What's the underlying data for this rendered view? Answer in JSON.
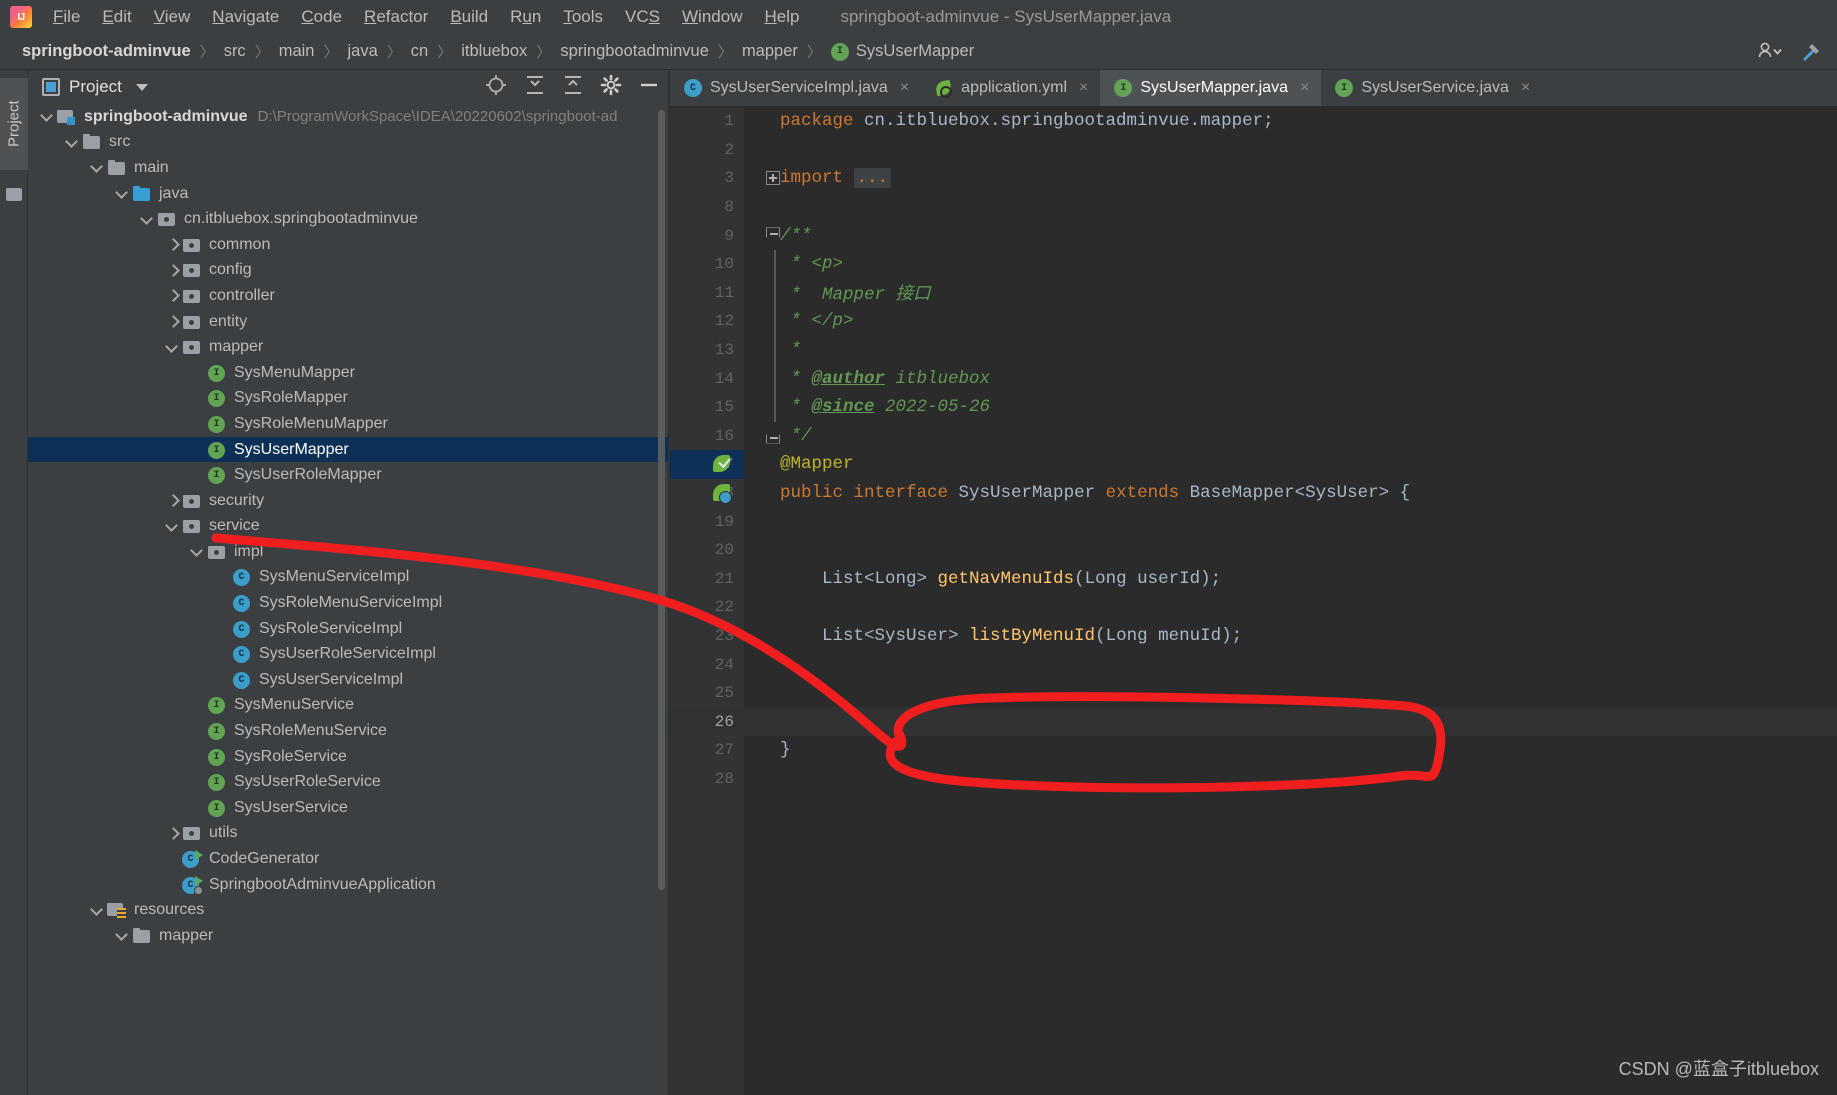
{
  "window": {
    "title": "springboot-adminvue - SysUserMapper.java",
    "logo_icon": "intellij-idea-logo"
  },
  "menubar": {
    "items": [
      {
        "label": "File",
        "mnemonic": "F"
      },
      {
        "label": "Edit",
        "mnemonic": "E"
      },
      {
        "label": "View",
        "mnemonic": "V"
      },
      {
        "label": "Navigate",
        "mnemonic": "N"
      },
      {
        "label": "Code",
        "mnemonic": "C"
      },
      {
        "label": "Refactor",
        "mnemonic": "R"
      },
      {
        "label": "Build",
        "mnemonic": "B"
      },
      {
        "label": "Run",
        "mnemonic": "u"
      },
      {
        "label": "Tools",
        "mnemonic": "T"
      },
      {
        "label": "VCS",
        "mnemonic": "S"
      },
      {
        "label": "Window",
        "mnemonic": "W"
      },
      {
        "label": "Help",
        "mnemonic": "H"
      }
    ]
  },
  "breadcrumb": {
    "separator": "〉",
    "items": [
      {
        "label": "springboot-adminvue",
        "bold": true,
        "icon": null
      },
      {
        "label": "src",
        "bold": false,
        "icon": null
      },
      {
        "label": "main",
        "bold": false,
        "icon": null
      },
      {
        "label": "java",
        "bold": false,
        "icon": null
      },
      {
        "label": "cn",
        "bold": false,
        "icon": null
      },
      {
        "label": "itbluebox",
        "bold": false,
        "icon": null
      },
      {
        "label": "springbootadminvue",
        "bold": false,
        "icon": null
      },
      {
        "label": "mapper",
        "bold": false,
        "icon": null
      },
      {
        "label": "SysUserMapper",
        "bold": false,
        "icon": "interface-icon"
      }
    ],
    "right_icons": [
      "user-access-icon",
      "chevron-down-icon",
      "hammer-icon"
    ]
  },
  "toolstrip": {
    "label": "Project",
    "icons": [
      "project-icon",
      "structure-icon"
    ]
  },
  "project_panel": {
    "title": "Project",
    "header_icons": [
      "locate-icon",
      "expand-all-icon",
      "collapse-all-icon",
      "settings-gear-icon",
      "hide-icon"
    ],
    "tree": [
      {
        "depth": 0,
        "arrow": "down",
        "icon": "module",
        "label": "springboot-adminvue",
        "bold": true,
        "subpath": "D:\\ProgramWorkSpace\\IDEA\\20220602\\springboot-ad",
        "selected": false
      },
      {
        "depth": 1,
        "arrow": "down",
        "icon": "folder",
        "label": "src",
        "bold": false,
        "subpath": "",
        "selected": false
      },
      {
        "depth": 2,
        "arrow": "down",
        "icon": "folder",
        "label": "main",
        "bold": false,
        "subpath": "",
        "selected": false
      },
      {
        "depth": 3,
        "arrow": "down",
        "icon": "folder-src",
        "label": "java",
        "bold": false,
        "subpath": "",
        "selected": false
      },
      {
        "depth": 4,
        "arrow": "down",
        "icon": "pkg",
        "label": "cn.itbluebox.springbootadminvue",
        "bold": false,
        "subpath": "",
        "selected": false
      },
      {
        "depth": 5,
        "arrow": "right",
        "icon": "pkg",
        "label": "common",
        "bold": false,
        "subpath": "",
        "selected": false
      },
      {
        "depth": 5,
        "arrow": "right",
        "icon": "pkg",
        "label": "config",
        "bold": false,
        "subpath": "",
        "selected": false
      },
      {
        "depth": 5,
        "arrow": "right",
        "icon": "pkg",
        "label": "controller",
        "bold": false,
        "subpath": "",
        "selected": false
      },
      {
        "depth": 5,
        "arrow": "right",
        "icon": "pkg",
        "label": "entity",
        "bold": false,
        "subpath": "",
        "selected": false
      },
      {
        "depth": 5,
        "arrow": "down",
        "icon": "pkg",
        "label": "mapper",
        "bold": false,
        "subpath": "",
        "selected": false
      },
      {
        "depth": 6,
        "arrow": "none",
        "icon": "iface",
        "label": "SysMenuMapper",
        "bold": false,
        "subpath": "",
        "selected": false
      },
      {
        "depth": 6,
        "arrow": "none",
        "icon": "iface",
        "label": "SysRoleMapper",
        "bold": false,
        "subpath": "",
        "selected": false
      },
      {
        "depth": 6,
        "arrow": "none",
        "icon": "iface",
        "label": "SysRoleMenuMapper",
        "bold": false,
        "subpath": "",
        "selected": false
      },
      {
        "depth": 6,
        "arrow": "none",
        "icon": "iface",
        "label": "SysUserMapper",
        "bold": false,
        "subpath": "",
        "selected": true
      },
      {
        "depth": 6,
        "arrow": "none",
        "icon": "iface",
        "label": "SysUserRoleMapper",
        "bold": false,
        "subpath": "",
        "selected": false
      },
      {
        "depth": 5,
        "arrow": "right",
        "icon": "pkg",
        "label": "security",
        "bold": false,
        "subpath": "",
        "selected": false
      },
      {
        "depth": 5,
        "arrow": "down",
        "icon": "pkg",
        "label": "service",
        "bold": false,
        "subpath": "",
        "selected": false
      },
      {
        "depth": 6,
        "arrow": "down",
        "icon": "pkg",
        "label": "impl",
        "bold": false,
        "subpath": "",
        "selected": false
      },
      {
        "depth": 7,
        "arrow": "none",
        "icon": "cls",
        "label": "SysMenuServiceImpl",
        "bold": false,
        "subpath": "",
        "selected": false
      },
      {
        "depth": 7,
        "arrow": "none",
        "icon": "cls",
        "label": "SysRoleMenuServiceImpl",
        "bold": false,
        "subpath": "",
        "selected": false
      },
      {
        "depth": 7,
        "arrow": "none",
        "icon": "cls",
        "label": "SysRoleServiceImpl",
        "bold": false,
        "subpath": "",
        "selected": false
      },
      {
        "depth": 7,
        "arrow": "none",
        "icon": "cls",
        "label": "SysUserRoleServiceImpl",
        "bold": false,
        "subpath": "",
        "selected": false
      },
      {
        "depth": 7,
        "arrow": "none",
        "icon": "cls",
        "label": "SysUserServiceImpl",
        "bold": false,
        "subpath": "",
        "selected": false
      },
      {
        "depth": 6,
        "arrow": "none",
        "icon": "iface",
        "label": "SysMenuService",
        "bold": false,
        "subpath": "",
        "selected": false
      },
      {
        "depth": 6,
        "arrow": "none",
        "icon": "iface",
        "label": "SysRoleMenuService",
        "bold": false,
        "subpath": "",
        "selected": false
      },
      {
        "depth": 6,
        "arrow": "none",
        "icon": "iface",
        "label": "SysRoleService",
        "bold": false,
        "subpath": "",
        "selected": false
      },
      {
        "depth": 6,
        "arrow": "none",
        "icon": "iface",
        "label": "SysUserRoleService",
        "bold": false,
        "subpath": "",
        "selected": false
      },
      {
        "depth": 6,
        "arrow": "none",
        "icon": "iface",
        "label": "SysUserService",
        "bold": false,
        "subpath": "",
        "selected": false
      },
      {
        "depth": 5,
        "arrow": "right",
        "icon": "pkg",
        "label": "utils",
        "bold": false,
        "subpath": "",
        "selected": false
      },
      {
        "depth": 5,
        "arrow": "none",
        "icon": "cls-run",
        "label": "CodeGenerator",
        "bold": false,
        "subpath": "",
        "selected": false
      },
      {
        "depth": 5,
        "arrow": "none",
        "icon": "cls-run-spring",
        "label": "SpringbootAdminvueApplication",
        "bold": false,
        "subpath": "",
        "selected": false
      },
      {
        "depth": 2,
        "arrow": "down",
        "icon": "resources",
        "label": "resources",
        "bold": false,
        "subpath": "",
        "selected": false
      },
      {
        "depth": 3,
        "arrow": "down",
        "icon": "folder",
        "label": "mapper",
        "bold": false,
        "subpath": "",
        "selected": false
      }
    ]
  },
  "editor": {
    "tabs": [
      {
        "label": "SysUserServiceImpl.java",
        "icon": "class-icon",
        "active": false,
        "close": "×"
      },
      {
        "label": "application.yml",
        "icon": "spring-yaml-icon",
        "active": false,
        "close": "×"
      },
      {
        "label": "SysUserMapper.java",
        "icon": "interface-icon",
        "active": true,
        "close": "×"
      },
      {
        "label": "SysUserService.java",
        "icon": "interface-icon",
        "active": false,
        "close": "×"
      }
    ],
    "lines": [
      {
        "num": "1",
        "fold": "none",
        "gutter": "none",
        "caret": false,
        "gutter_hl": false,
        "tokens": [
          {
            "t": "package ",
            "c": "kw"
          },
          {
            "t": "cn.itbluebox.springbootadminvue.mapper;",
            "c": "txt"
          }
        ]
      },
      {
        "num": "2",
        "fold": "none",
        "gutter": "none",
        "caret": false,
        "gutter_hl": false,
        "tokens": []
      },
      {
        "num": "3",
        "fold": "plus",
        "gutter": "none",
        "caret": false,
        "gutter_hl": false,
        "tokens": [
          {
            "t": "import ",
            "c": "kw"
          },
          {
            "t": "...",
            "c": "foldimport"
          }
        ]
      },
      {
        "num": "8",
        "fold": "none",
        "gutter": "none",
        "caret": false,
        "gutter_hl": false,
        "tokens": []
      },
      {
        "num": "9",
        "fold": "start",
        "gutter": "none",
        "caret": false,
        "gutter_hl": false,
        "tokens": [
          {
            "t": "/**",
            "c": "cmt"
          }
        ]
      },
      {
        "num": "10",
        "fold": "line",
        "gutter": "none",
        "caret": false,
        "gutter_hl": false,
        "tokens": [
          {
            "t": " * <p>",
            "c": "cmt"
          }
        ]
      },
      {
        "num": "11",
        "fold": "line",
        "gutter": "none",
        "caret": false,
        "gutter_hl": false,
        "tokens": [
          {
            "t": " *  Mapper 接口",
            "c": "cmt"
          }
        ]
      },
      {
        "num": "12",
        "fold": "line",
        "gutter": "none",
        "caret": false,
        "gutter_hl": false,
        "tokens": [
          {
            "t": " * </p>",
            "c": "cmt"
          }
        ]
      },
      {
        "num": "13",
        "fold": "line",
        "gutter": "none",
        "caret": false,
        "gutter_hl": false,
        "tokens": [
          {
            "t": " *",
            "c": "cmt"
          }
        ]
      },
      {
        "num": "14",
        "fold": "line",
        "gutter": "none",
        "caret": false,
        "gutter_hl": false,
        "tokens": [
          {
            "t": " * ",
            "c": "cmt"
          },
          {
            "t": "@author",
            "c": "cmttag"
          },
          {
            "t": " itbluebox",
            "c": "cmt"
          }
        ]
      },
      {
        "num": "15",
        "fold": "line",
        "gutter": "none",
        "caret": false,
        "gutter_hl": false,
        "tokens": [
          {
            "t": " * ",
            "c": "cmt"
          },
          {
            "t": "@since",
            "c": "cmttag"
          },
          {
            "t": " 2022-05-26",
            "c": "cmt"
          }
        ]
      },
      {
        "num": "16",
        "fold": "end",
        "gutter": "none",
        "caret": false,
        "gutter_hl": false,
        "tokens": [
          {
            "t": " */",
            "c": "cmt"
          }
        ]
      },
      {
        "num": "17",
        "fold": "none",
        "gutter": "spring-check",
        "caret": false,
        "gutter_hl": true,
        "tokens": [
          {
            "t": "@Mapper",
            "c": "ann"
          }
        ]
      },
      {
        "num": "18",
        "fold": "none",
        "gutter": "spring-bean",
        "caret": false,
        "gutter_hl": false,
        "tokens": [
          {
            "t": "public ",
            "c": "kw"
          },
          {
            "t": "interface ",
            "c": "kw"
          },
          {
            "t": "SysUserMapper ",
            "c": "typ"
          },
          {
            "t": "extends ",
            "c": "kw"
          },
          {
            "t": "BaseMapper<SysUser> {",
            "c": "typ"
          }
        ]
      },
      {
        "num": "19",
        "fold": "none",
        "gutter": "none",
        "caret": false,
        "gutter_hl": false,
        "tokens": []
      },
      {
        "num": "20",
        "fold": "none",
        "gutter": "none",
        "caret": false,
        "gutter_hl": false,
        "tokens": []
      },
      {
        "num": "21",
        "fold": "none",
        "gutter": "none",
        "caret": false,
        "gutter_hl": false,
        "tokens": [
          {
            "t": "    List<Long> ",
            "c": "typ"
          },
          {
            "t": "getNavMenuIds",
            "c": "mth"
          },
          {
            "t": "(Long userId);",
            "c": "typ"
          }
        ]
      },
      {
        "num": "22",
        "fold": "none",
        "gutter": "none",
        "caret": false,
        "gutter_hl": false,
        "tokens": []
      },
      {
        "num": "23",
        "fold": "none",
        "gutter": "none",
        "caret": false,
        "gutter_hl": false,
        "tokens": [
          {
            "t": "    List<SysUser> ",
            "c": "typ"
          },
          {
            "t": "listByMenuId",
            "c": "mth"
          },
          {
            "t": "(Long menuId);",
            "c": "typ"
          }
        ]
      },
      {
        "num": "24",
        "fold": "none",
        "gutter": "none",
        "caret": false,
        "gutter_hl": false,
        "tokens": []
      },
      {
        "num": "25",
        "fold": "none",
        "gutter": "none",
        "caret": false,
        "gutter_hl": false,
        "tokens": []
      },
      {
        "num": "26",
        "fold": "none",
        "gutter": "none",
        "caret": true,
        "gutter_hl": false,
        "tokens": []
      },
      {
        "num": "27",
        "fold": "none",
        "gutter": "none",
        "caret": false,
        "gutter_hl": false,
        "tokens": [
          {
            "t": "}",
            "c": "typ"
          }
        ]
      },
      {
        "num": "28",
        "fold": "none",
        "gutter": "none",
        "caret": false,
        "gutter_hl": false,
        "tokens": []
      }
    ]
  },
  "annotation": {
    "color": "#f01e1e",
    "description": "hand-drawn red arrow from SysUserMapper tree node to circled line 23"
  },
  "watermark": {
    "text": "CSDN @蓝盒子itbluebox"
  },
  "colors": {
    "window_bg": "#3c3f41",
    "editor_bg": "#2b2b2b",
    "gutter_bg": "#313335",
    "selection": "#0d3056",
    "accent_green": "#62a355",
    "accent_blue": "#3c9dc9",
    "annotation_red": "#f01e1e"
  }
}
